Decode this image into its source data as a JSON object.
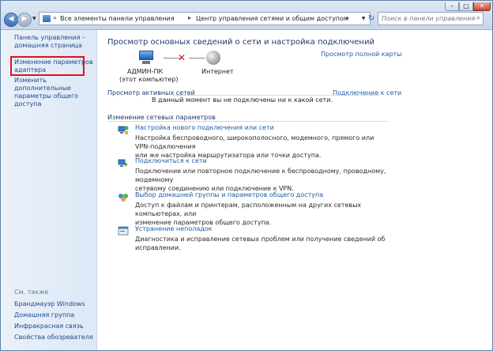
{
  "address": {
    "crumb1": "Все элементы панели управления",
    "crumb2": "Центр управления сетями и общим доступом",
    "search_placeholder": "Поиск в панели управления"
  },
  "window_buttons": {
    "minimize": "–",
    "maximize": "□",
    "close": "✕"
  },
  "sidebar": {
    "home_line1": "Панель управления –",
    "home_line2": "домашняя страница",
    "adapter_line1": "Изменение параметров",
    "adapter_line2": "адаптера",
    "sharing_line1": "Изменить дополнительные",
    "sharing_line2": "параметры общего доступа",
    "see_also": "См. также",
    "links": [
      "Брандмауэр Windows",
      "Домашняя группа",
      "Инфракрасная связь",
      "Свойства обозревателя"
    ]
  },
  "main": {
    "title": "Просмотр основных сведений о сети и настройка подключений",
    "full_map": "Просмотр полной карты",
    "computer_name": "АДМИН-ПК",
    "computer_sub": "(этот компьютер)",
    "internet": "Интернет",
    "active_networks": "Просмотр активных сетей",
    "connect_or_disconnect": "Подключение к сети",
    "no_connection": "В данный момент вы не подключены ни к какой сети.",
    "change_settings": "Изменение сетевых параметров",
    "tasks": [
      {
        "title": "Настройка нового подключения или сети",
        "desc1": "Настройка беспроводного, широкополосного, модемного, прямого или VPN-подключения",
        "desc2": "или же настройка маршрутизатора или точки доступа."
      },
      {
        "title": "Подключиться к сети",
        "desc1": "Подключение или повторное подключение к беспроводному, проводному, модемному",
        "desc2": "сетевому соединению или подключение к VPN."
      },
      {
        "title": "Выбор домашней группы и параметров общего доступа",
        "desc1": "Доступ к файлам и принтерам, расположенным на других сетевых компьютерах, или",
        "desc2": "изменение параметров общего доступа."
      },
      {
        "title": "Устранение неполадок",
        "desc1": "Диагностика и исправление сетевых проблем или получение сведений об исправлении.",
        "desc2": ""
      }
    ]
  }
}
